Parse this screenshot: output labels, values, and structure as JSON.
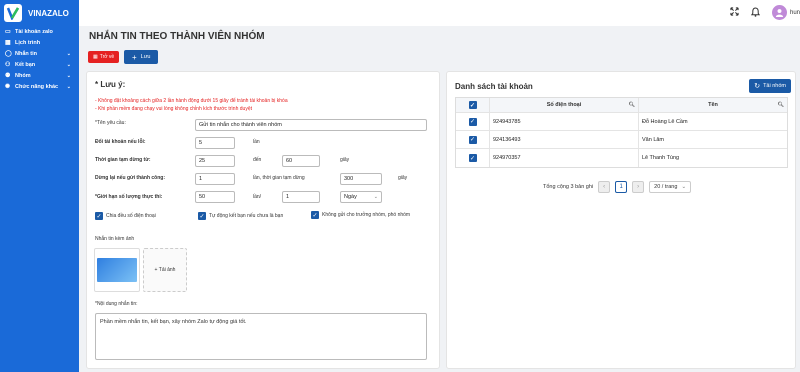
{
  "brand": {
    "name": "VINAZALO"
  },
  "sidebar": {
    "items": [
      {
        "label": "Tài khoản zalo",
        "icon": "monitor-icon",
        "has_chevron": false
      },
      {
        "label": "Lịch trình",
        "icon": "calendar-icon",
        "has_chevron": false
      },
      {
        "label": "Nhắn tin",
        "icon": "chat-icon",
        "has_chevron": true
      },
      {
        "label": "Kết bạn",
        "icon": "user-add-icon",
        "has_chevron": true
      },
      {
        "label": "Nhóm",
        "icon": "group-icon",
        "has_chevron": true
      },
      {
        "label": "Chức năng khác",
        "icon": "settings-icon",
        "has_chevron": true
      }
    ]
  },
  "topbar": {
    "user_name": "hun"
  },
  "page": {
    "title": "NHẮN TIN THEO THÀNH VIÊN NHÓM"
  },
  "actions": {
    "back_label": "Trở về",
    "save_label": "Lưu"
  },
  "form": {
    "heading": "* Lưu ý:",
    "notes": [
      "- Không đặt khoảng cách giữa 2 lần hành động dưới 15 giây để tránh tài khoản bị khóa",
      "- Khi phần mềm đang chạy vui lòng không chỉnh kích thước trình duyệt"
    ],
    "request_name_label": "*Tên yêu cầu:",
    "request_name_value": "Gửi tin nhắn cho thành viên nhóm",
    "switch_account_label": "Đổi tài khoản nếu lỗi:",
    "switch_account_value": "5",
    "switch_account_unit": "lần",
    "pause_label": "Thời gian tạm dừng từ:",
    "pause_from": "25",
    "pause_to_label": "đến",
    "pause_to": "60",
    "pause_unit": "giây",
    "stop_success_label": "Dừng lại nếu gửi thành công:",
    "stop_success_value": "1",
    "stop_success_mid": "lần, thời gian tạm dừng",
    "stop_success_pause": "300",
    "stop_success_unit": "giây",
    "limit_label": "*Giới hạn số lượng thực thi:",
    "limit_value": "50",
    "limit_per_label": "lần/",
    "limit_per_value": "1",
    "limit_period": "Ngày",
    "check_split_phone": "Chia đều số điện thoại",
    "check_auto_friend": "Tự động kết bạn nếu chưa là bạn",
    "check_skip_admin": "Không gửi cho trưởng nhóm, phó nhóm",
    "attach_label": "Nhắn tin kèm ảnh",
    "upload_label": "+ Tải ảnh",
    "message_label": "*Nội dung nhắn tin:",
    "message_value": "Phần mềm nhắn tin, kết bạn, xây nhóm Zalo tự động giá tốt."
  },
  "accounts": {
    "heading": "Danh sách tài khoản",
    "load_button": "Tải nhóm",
    "columns": [
      "Số điện thoại",
      "Tên"
    ],
    "rows": [
      {
        "phone": "924943785",
        "name": "Đỗ Hoàng Lê Cầm"
      },
      {
        "phone": "924136493",
        "name": "Văn Lâm"
      },
      {
        "phone": "924970357",
        "name": "Lê Thanh Tùng"
      }
    ],
    "total_label": "Tổng cộng 3 bản ghi",
    "current_page": "1",
    "page_size": "20 / trang"
  }
}
